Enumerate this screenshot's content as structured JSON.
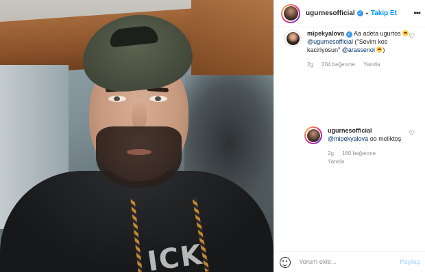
{
  "post": {
    "author": "ugurnesofficial",
    "follow_label": "Takip Et",
    "more_label": "•••",
    "separator": "•"
  },
  "photo": {
    "hoodie_print": "ICK"
  },
  "comments": [
    {
      "username": "mipekyalova",
      "text_before": "Aa adeta ugurtos",
      "mention1": "@ugurnesofficial",
      "text_middle": "(\"Sevim kos kaciriyosun\"",
      "mention2": "@arassenol",
      "time": "2g",
      "likes": "204 beğenme",
      "reply_label": "Yanıtla"
    },
    {
      "username": "ugurnesofficial",
      "mention": "@mipekyalova",
      "text": "oo meliktoş",
      "time": "2g",
      "likes": "160 beğenme",
      "reply_label": "Yanıtla"
    }
  ],
  "composer": {
    "placeholder": "Yorum ekle...",
    "share_label": "Paylaş"
  },
  "icons": {
    "heart": "♡",
    "verified": "✓",
    "emoji": "emoji-icon",
    "smile": "smile-icon"
  },
  "colors": {
    "accent": "#0095f6",
    "verified": "#3897f0",
    "mention": "#00376b",
    "muted": "#8e8e8e",
    "share_disabled": "#b3dbff"
  }
}
